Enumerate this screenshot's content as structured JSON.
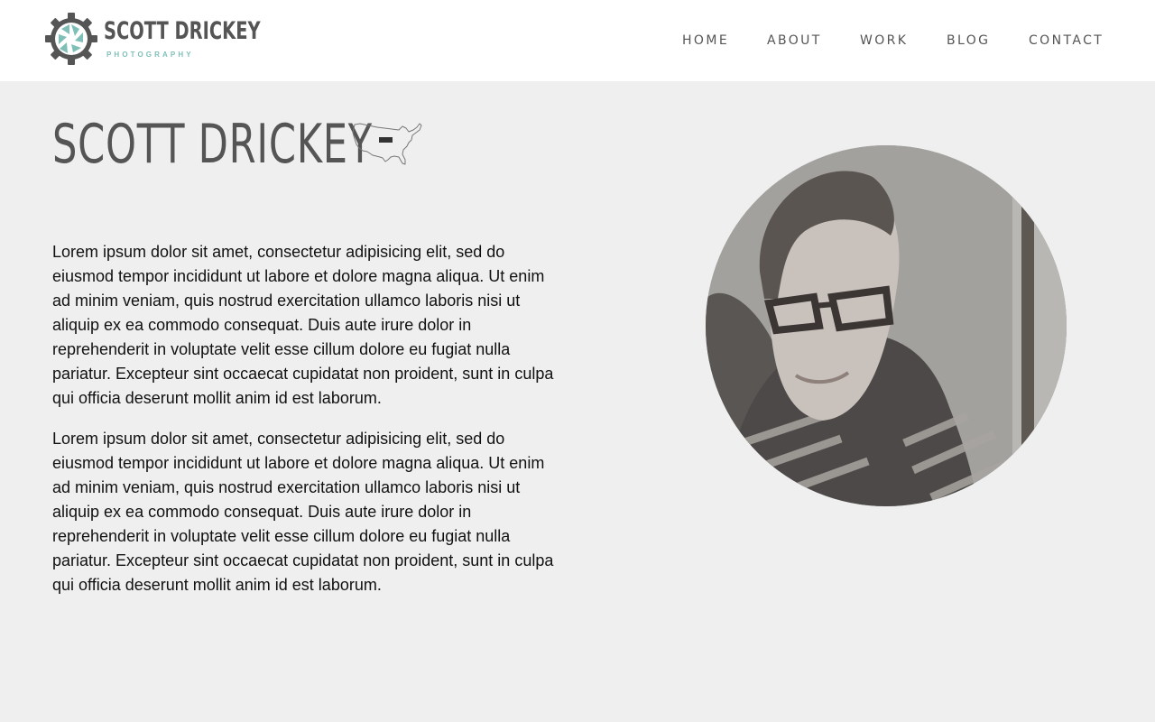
{
  "site": {
    "logo": {
      "name": "SCOTT DRICKEY",
      "tagline": "PHOTOGRAPHY",
      "icon": "camera-aperture-gear-icon",
      "accent_color": "#7fbfb8",
      "text_color": "#555555"
    },
    "nav": {
      "items": [
        {
          "label": "HOME"
        },
        {
          "label": "ABOUT"
        },
        {
          "label": "WORK"
        },
        {
          "label": "BLOG"
        },
        {
          "label": "CONTACT"
        }
      ]
    }
  },
  "main": {
    "title": "SCOTT DRICKEY",
    "title_icon": "usa-map-icon",
    "paragraphs": [
      "Lorem ipsum dolor sit amet, consectetur adipisicing elit, sed do eiusmod tempor incididunt ut labore et dolore magna aliqua. Ut enim ad minim veniam, quis nostrud exercitation ullamco laboris nisi ut aliquip ex ea commodo consequat. Duis aute irure dolor in reprehenderit in voluptate velit esse cillum dolore eu fugiat nulla pariatur. Excepteur sint occaecat cupidatat non proident, sunt in culpa qui officia deserunt mollit anim id est laborum.",
      "Lorem ipsum dolor sit amet, consectetur adipisicing elit, sed do eiusmod tempor incididunt ut labore et dolore magna aliqua. Ut enim ad minim veniam, quis nostrud exercitation ullamco laboris nisi ut aliquip ex ea commodo consequat. Duis aute irure dolor in reprehenderit in voluptate velit esse cillum dolore eu fugiat nulla pariatur. Excepteur sint occaecat cupidatat non proident, sunt in culpa qui officia deserunt mollit anim id est laborum."
    ],
    "portrait": {
      "icon": "portrait-photo"
    }
  },
  "colors": {
    "background": "#efefef",
    "header_background": "#ffffff",
    "heading": "#555555",
    "body_text": "#111111"
  }
}
